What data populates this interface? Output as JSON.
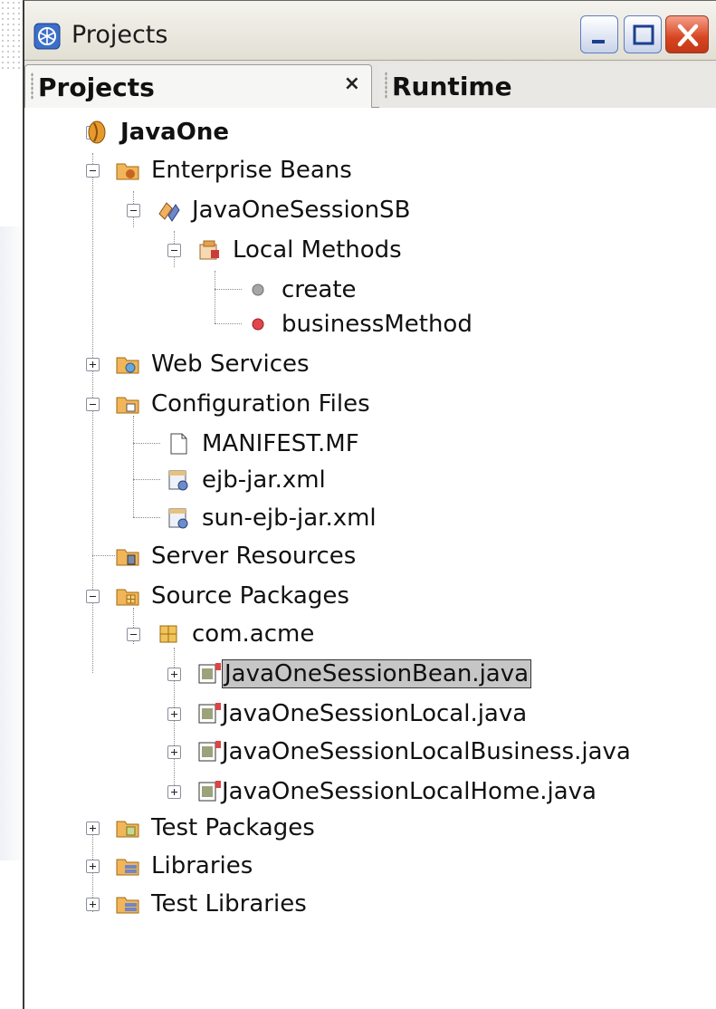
{
  "window": {
    "title": "Projects",
    "controls": {
      "minimize": "minimize-button",
      "maximize": "maximize-button",
      "close": "close-button"
    }
  },
  "tabs": [
    {
      "label": "Projects",
      "close_symbol": "×",
      "active": true
    },
    {
      "label": "Runtime",
      "active": false
    }
  ],
  "tree": {
    "project": "JavaOne",
    "enterprise_beans": "Enterprise Beans",
    "session_bean": "JavaOneSessionSB",
    "local_methods": "Local Methods",
    "method_create": "create",
    "method_business": "businessMethod",
    "web_services": "Web Services",
    "config_files": "Configuration Files",
    "manifest": "MANIFEST.MF",
    "ejb_jar": "ejb-jar.xml",
    "sun_ejb_jar": "sun-ejb-jar.xml",
    "server_resources": "Server Resources",
    "source_packages": "Source Packages",
    "package": "com.acme",
    "file_bean": "JavaOneSessionBean.java",
    "file_local": "JavaOneSessionLocal.java",
    "file_local_business": "JavaOneSessionLocalBusiness.java",
    "file_local_home": "JavaOneSessionLocalHome.java",
    "test_packages": "Test Packages",
    "libraries": "Libraries",
    "test_libraries": "Test Libraries"
  },
  "selected_item": "JavaOneSessionBean.java",
  "colors": {
    "folder": "#e9a84b",
    "selection": "#c6c6c6",
    "close_button": "#d7441f",
    "method_gray": "#9a9a9a",
    "method_red": "#e0464b"
  }
}
